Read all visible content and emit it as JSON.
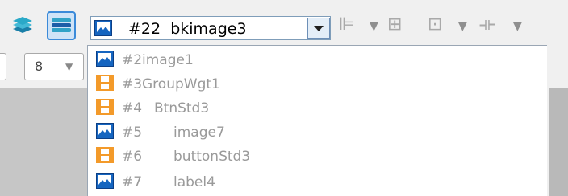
{
  "toolbar": {
    "layer_buttons": [
      {
        "icon": "layers-icon"
      },
      {
        "icon": "layers-selected-icon",
        "active": true
      }
    ],
    "widget_selector": {
      "icon": "image-widget-icon",
      "id": "#22",
      "name": "bkimage3"
    },
    "tools": [
      {
        "icon": "align-left-icon",
        "glyph": "⊫"
      },
      {
        "icon": "move-icon",
        "glyph": "⊞"
      },
      {
        "icon": "distribute-icon",
        "glyph": "⊡"
      },
      {
        "icon": "spacing-icon",
        "glyph": "⟛"
      }
    ]
  },
  "property_panel": {
    "number_value": "8"
  },
  "dropdown": {
    "items": [
      {
        "type": "image",
        "id": "#2",
        "name": "image1",
        "indent": 0
      },
      {
        "type": "group",
        "id": "#3",
        "name": "GroupWgt1",
        "indent": 0
      },
      {
        "type": "group",
        "id": "#4",
        "name": "BtnStd3",
        "indent": 1
      },
      {
        "type": "image",
        "id": "#5",
        "name": "image7",
        "indent": 2
      },
      {
        "type": "group",
        "id": "#6",
        "name": "buttonStd3",
        "indent": 2
      },
      {
        "type": "image",
        "id": "#7",
        "name": "label4",
        "indent": 2
      }
    ]
  },
  "colors": {
    "image_icon": "#1565c0",
    "group_icon": "#f39a2a",
    "selection_border": "#3b8ad9"
  }
}
